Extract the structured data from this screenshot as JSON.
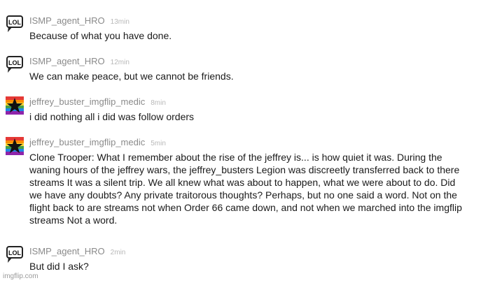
{
  "comments": [
    {
      "user": "ISMP_agent_HRO",
      "time": "13min",
      "avatar_icon": "lol-speech-bubble-icon",
      "text": "Because of what you have done."
    },
    {
      "user": "ISMP_agent_HRO",
      "time": "12min",
      "avatar_icon": "lol-speech-bubble-icon",
      "text": "We can make peace, but we cannot be friends."
    },
    {
      "user": "jeffrey_buster_imgflip_medic",
      "time": "8min",
      "avatar_icon": "rainbow-star-icon",
      "text": "i did nothing all i did was follow orders"
    },
    {
      "user": "jeffrey_buster_imgflip_medic",
      "time": "5min",
      "avatar_icon": "rainbow-star-icon",
      "text_lines": [
        "Clone Trooper: What I remember about the rise of the jeffrey is... is how quiet it was. During the",
        "waning hours of the jeffrey wars, the jeffrey_busters Legion was discreetly transferred back to there",
        "streams It was a silent trip. We all knew what was about to happen, what we were about to do. Did",
        "we have any doubts? Any private traitorous thoughts? Perhaps, but no one said a word. Not on the",
        "flight back to are streams not when Order 66 came down, and not when we marched into the imgflip",
        "streams Not a word."
      ]
    },
    {
      "user": "ISMP_agent_HRO",
      "time": "2min",
      "avatar_icon": "lol-speech-bubble-icon",
      "text": "But did I ask?"
    }
  ],
  "watermark": "imgflip.com",
  "colors": {
    "username": "#8a8a8a",
    "timestamp": "#b8b8b8",
    "body_text": "#1a1a1a",
    "rainbow": [
      "#e53935",
      "#fb8c00",
      "#fdd835",
      "#43a047",
      "#1e88e5",
      "#8e24aa"
    ]
  }
}
